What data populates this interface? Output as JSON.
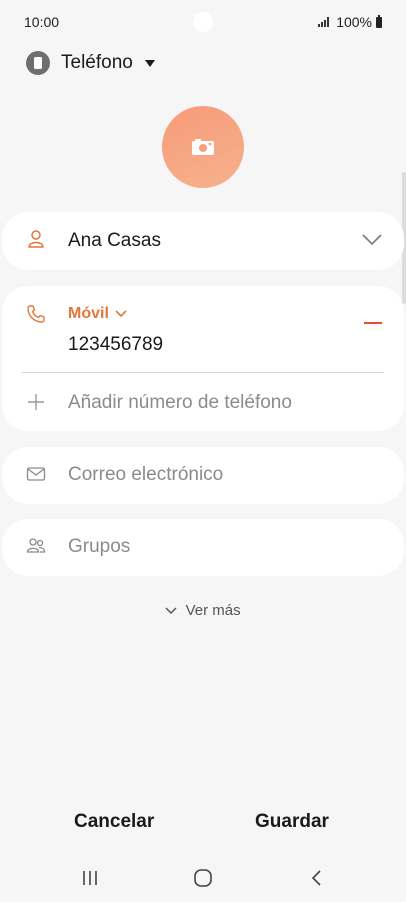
{
  "status_bar": {
    "time": "10:00",
    "battery": "100%"
  },
  "header": {
    "account_label": "Teléfono"
  },
  "name_field": {
    "value": "Ana Casas"
  },
  "phone_field": {
    "type_label": "Móvil",
    "number": "123456789",
    "add_label": "Añadir número de teléfono"
  },
  "email_field": {
    "placeholder": "Correo electrónico"
  },
  "groups_field": {
    "label": "Grupos"
  },
  "see_more": {
    "label": "Ver más"
  },
  "footer": {
    "cancel_label": "Cancelar",
    "save_label": "Guardar"
  },
  "colors": {
    "accent": "#e4763b",
    "photo_gradient_start": "#f79a79",
    "remove": "#e44f33"
  }
}
